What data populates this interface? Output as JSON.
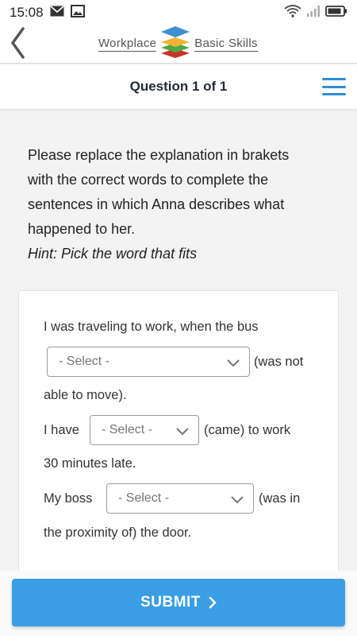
{
  "status_bar": {
    "time": "15:08"
  },
  "header": {
    "logo_left": "Workplace",
    "logo_right": "Basic Skills"
  },
  "question_bar": {
    "title": "Question 1 of 1"
  },
  "instructions": {
    "line1": "Please replace the explanation in brakets",
    "line2": "with the correct words to complete the",
    "line3": "sentences in which Anna describes what",
    "line4": "happened to her.",
    "hint": "Hint: Pick the word that fits"
  },
  "exercise": {
    "sentence1_start": "I was traveling to work, when the bus",
    "select1": "- Select -",
    "sentence1_after": "(was not",
    "sentence1_end": "able to move).",
    "sentence2_start": "I have",
    "select2": "- Select -",
    "sentence2_after": "(came) to work",
    "sentence2_end": "30 minutes late.",
    "sentence3_start": "My boss",
    "select3": "- Select -",
    "sentence3_after": "(was in",
    "sentence3_end": "the proximity of) the door."
  },
  "submit": {
    "label": "SUBMIT"
  },
  "colors": {
    "accent": "#3a9ee4",
    "menu": "#2e8fd6",
    "logo_blue": "#3f8fd2",
    "logo_yellow": "#f2b233",
    "logo_green": "#4aa843",
    "logo_red": "#c8332b"
  }
}
